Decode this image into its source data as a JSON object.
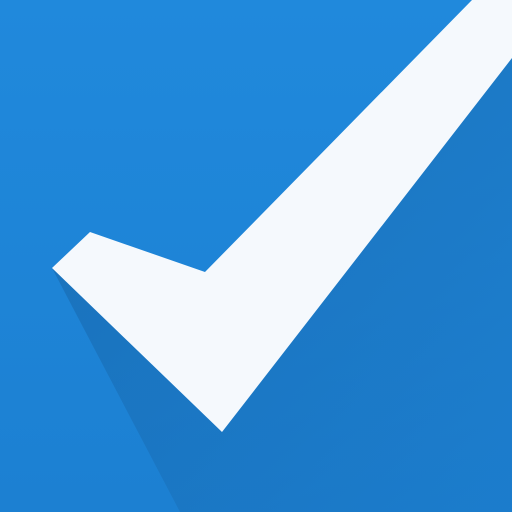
{
  "icon": {
    "name": "checkmark-icon",
    "colors": {
      "background_top": "#2089dc",
      "background_bottom": "#1c80d2",
      "shadow": "#1868ad",
      "checkmark": "#f5f9fd"
    }
  }
}
